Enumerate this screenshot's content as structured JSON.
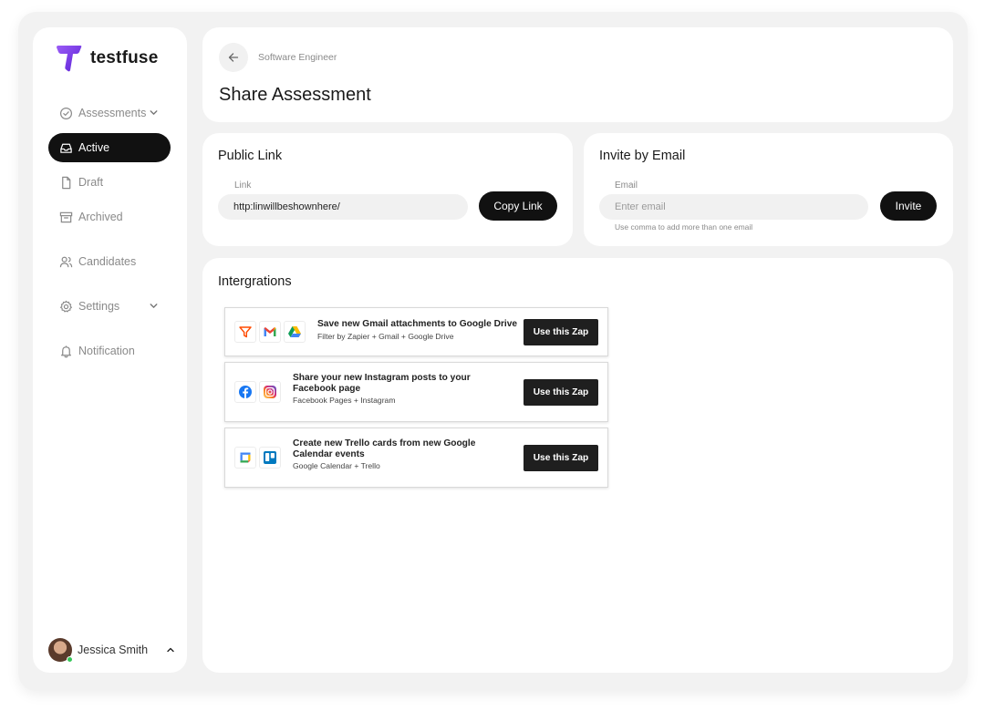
{
  "app": {
    "name": "testfuse",
    "brand_color": "#7b3fe4"
  },
  "sidebar": {
    "items": [
      {
        "label": "Assessments",
        "icon": "check-circle-icon",
        "has_chevron": true,
        "active": false
      },
      {
        "label": "Active",
        "icon": "inbox-icon",
        "active": true
      },
      {
        "label": "Draft",
        "icon": "file-icon",
        "active": false
      },
      {
        "label": "Archived",
        "icon": "archive-icon",
        "active": false
      },
      {
        "label": "Candidates",
        "icon": "users-icon",
        "active": false
      },
      {
        "label": "Settings",
        "icon": "gear-icon",
        "has_chevron": true,
        "active": false
      },
      {
        "label": "Notification",
        "icon": "bell-icon",
        "active": false
      }
    ],
    "user": {
      "name": "Jessica Smith",
      "status_color": "#35c759"
    }
  },
  "header": {
    "breadcrumb": "Software Engineer",
    "title": "Share Assessment"
  },
  "public_link": {
    "title": "Public Link",
    "field_label": "Link",
    "value": "http:linwillbeshownhere/",
    "button": "Copy Link"
  },
  "invite": {
    "title": "Invite by Email",
    "field_label": "Email",
    "placeholder": "Enter email",
    "hint": "Use comma to add more than one email",
    "button": "Invite"
  },
  "integrations": {
    "title": "Intergrations",
    "zaps": [
      {
        "title": "Save new Gmail attachments to Google Drive",
        "subtitle": "Filter by Zapier + Gmail + Google Drive",
        "icons": [
          "filter-icon",
          "gmail-icon",
          "google-drive-icon"
        ],
        "button": "Use this Zap"
      },
      {
        "title": "Share your new Instagram posts to your Facebook page",
        "subtitle": "Facebook Pages + Instagram",
        "icons": [
          "facebook-icon",
          "instagram-icon"
        ],
        "button": "Use this Zap"
      },
      {
        "title": "Create new Trello cards from new Google Calendar events",
        "subtitle": "Google Calendar + Trello",
        "icons": [
          "google-calendar-icon",
          "trello-icon"
        ],
        "button": "Use this Zap"
      }
    ]
  }
}
